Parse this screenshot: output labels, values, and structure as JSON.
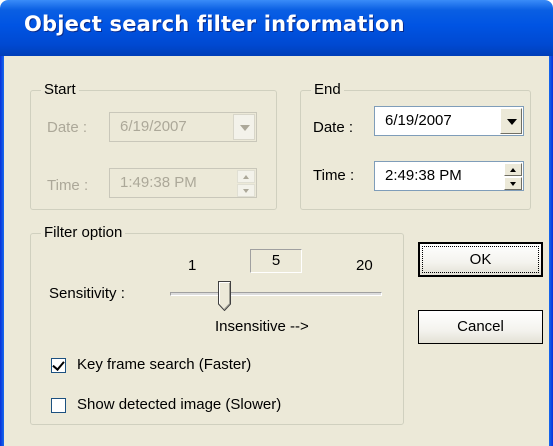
{
  "window": {
    "title": "Object search filter information"
  },
  "start": {
    "group_label": "Start",
    "date_label": "Date :",
    "date_value": "6/19/2007",
    "time_label": "Time :",
    "time_value": "1:49:38 PM",
    "enabled": false
  },
  "end": {
    "group_label": "End",
    "date_label": "Date :",
    "date_value": "6/19/2007",
    "time_label": "Time :",
    "time_value": "2:49:38 PM",
    "enabled": true
  },
  "filter": {
    "group_label": "Filter option",
    "sensitivity_label": "Sensitivity :",
    "slider_min": "1",
    "slider_value": "5",
    "slider_max": "20",
    "slider_hint": "Insensitive -->",
    "key_frame_label": "Key frame search (Faster)",
    "key_frame_checked": true,
    "show_image_label": "Show detected image (Slower)",
    "show_image_checked": false
  },
  "buttons": {
    "ok": "OK",
    "cancel": "Cancel"
  },
  "colors": {
    "titlebar": "#0054e3",
    "dialog_bg": "#ece9d8",
    "disabled_text": "#aca899"
  }
}
